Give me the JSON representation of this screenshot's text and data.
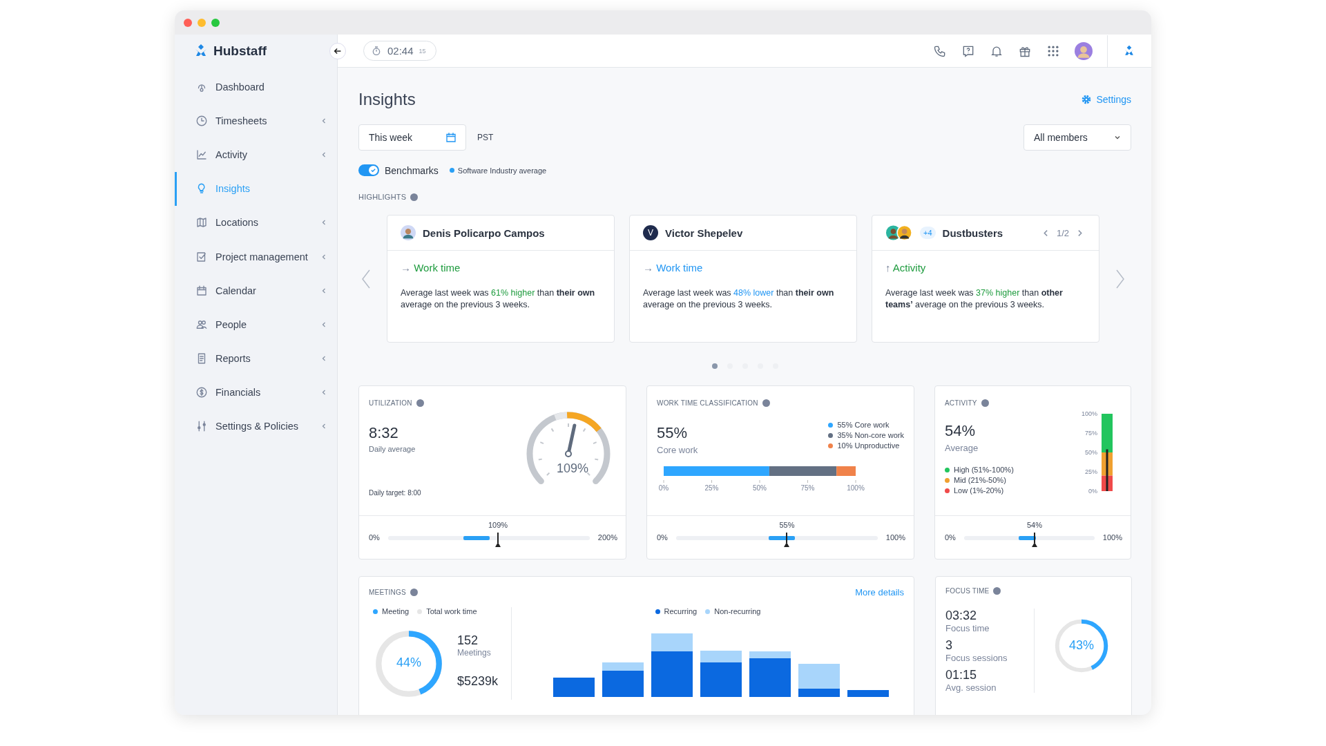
{
  "sidebar": {
    "logo": "Hubstaff",
    "items": [
      {
        "label": "Dashboard",
        "selected": false,
        "expandable": false
      },
      {
        "label": "Timesheets",
        "selected": false,
        "expandable": true
      },
      {
        "label": "Activity",
        "selected": false,
        "expandable": true
      },
      {
        "label": "Insights",
        "selected": true,
        "expandable": false
      },
      {
        "label": "Locations",
        "selected": false,
        "expandable": true
      },
      {
        "label": "Project management",
        "selected": false,
        "expandable": true
      },
      {
        "label": "Calendar",
        "selected": false,
        "expandable": true
      },
      {
        "label": "People",
        "selected": false,
        "expandable": true
      },
      {
        "label": "Reports",
        "selected": false,
        "expandable": true
      },
      {
        "label": "Financials",
        "selected": false,
        "expandable": true
      },
      {
        "label": "Settings & Policies",
        "selected": false,
        "expandable": true
      }
    ]
  },
  "topbar": {
    "timer": "02:44",
    "timer_seconds": "15"
  },
  "page": {
    "title": "Insights",
    "settings": "Settings",
    "date_range": "This week",
    "timezone": "PST",
    "members": "All members",
    "benchmarks": {
      "label": "Benchmarks",
      "on": true
    },
    "benchmark_source": "Software Industry average"
  },
  "highlights": {
    "title": "HIGHLIGHTS",
    "cards": [
      {
        "kind": "person",
        "name": "Denis Policarpo Campos",
        "arrow": "→",
        "metric": "Work time",
        "color": "#1e9b3e",
        "before": "Average last week was ",
        "highlight": "61% higher",
        "after": " than **their own** average on the previous 3 weeks."
      },
      {
        "kind": "initial",
        "initial": "V",
        "name": "Victor Shepelev",
        "arrow": "→",
        "metric": "Work time",
        "color": "#2196f3",
        "before": "Average last week was ",
        "highlight": "48% lower",
        "after": " than **their own** average on the previous 3 weeks."
      },
      {
        "kind": "team",
        "extra": "+4",
        "name": "Dustbusters",
        "pager": "1/2",
        "arrow": "↑",
        "metric": "Activity",
        "color": "#1e9b3e",
        "before": "Average last week was ",
        "highlight": "37% higher",
        "after": " than **other teams’** average on the previous 3 weeks."
      }
    ],
    "pages": [
      {
        "selected": true
      },
      {
        "selected": false
      },
      {
        "selected": false
      },
      {
        "selected": false
      },
      {
        "selected": false
      }
    ]
  },
  "utilization": {
    "title": "UTILIZATION",
    "value": "8:32",
    "caption": "Daily average",
    "target": "Daily target: 8:00",
    "gauge": {
      "level": 0.545,
      "label": "109%"
    },
    "meter": {
      "min": "0%",
      "max": "200%",
      "reading": "109%",
      "level": 0.545
    }
  },
  "work_time_classification": {
    "title": "WORK TIME CLASSIFICATION",
    "value": "55%",
    "caption": "Core work",
    "chart_data": {
      "type": "bar",
      "orientation": "horizontal",
      "stacked": true,
      "series": [
        {
          "name": "55% Core work",
          "color": "#2ea6ff",
          "values": [
            55
          ]
        },
        {
          "name": "35% Non-core work",
          "color": "#637083",
          "values": [
            35
          ]
        },
        {
          "name": "10% Unproductive",
          "color": "#f0824a",
          "values": [
            10
          ]
        }
      ],
      "xlim": [
        0,
        100
      ],
      "xticks": [
        {
          "value": 0,
          "label": "0%"
        },
        {
          "value": 25,
          "label": "25%"
        },
        {
          "value": 50,
          "label": "50%"
        },
        {
          "value": 75,
          "label": "75%"
        },
        {
          "value": 100,
          "label": "100%"
        }
      ]
    },
    "meter": {
      "min": "0%",
      "max": "100%",
      "reading": "55%",
      "level": 0.55
    }
  },
  "activity": {
    "title": "ACTIVITY",
    "value": "54%",
    "caption": "Average",
    "level": 0.54,
    "chart_data": {
      "type": "bar",
      "orientation": "vertical",
      "stacked": true,
      "series": [
        {
          "name": "High (51%-100%)",
          "color": "#22c55e",
          "values": [
            50
          ]
        },
        {
          "name": "Mid (21%-50%)",
          "color": "#f0a030",
          "values": [
            30
          ]
        },
        {
          "name": "Low (1%-20%)",
          "color": "#f04a4a",
          "values": [
            20
          ]
        }
      ],
      "ylim": [
        0,
        100
      ],
      "yticks": [
        {
          "value": 0,
          "label": "0%"
        },
        {
          "value": 25,
          "label": "25%"
        },
        {
          "value": 50,
          "label": "50%"
        },
        {
          "value": 75,
          "label": "75%"
        },
        {
          "value": 100,
          "label": "100%"
        }
      ]
    },
    "meter": {
      "min": "0%",
      "max": "100%",
      "reading": "54%",
      "level": 0.54
    }
  },
  "meetings": {
    "title": "MEETINGS",
    "link": "More details",
    "legend": [
      {
        "label": "Meeting",
        "color": "#2ea6ff"
      },
      {
        "label": "Total work time",
        "color": "#e6e6e6"
      }
    ],
    "donut": {
      "level": 0.44,
      "label": "44%"
    },
    "stats": [
      {
        "value": "152",
        "label": "Meetings"
      },
      {
        "value": "$5239k"
      }
    ],
    "bar_legend": [
      {
        "label": "Recurring",
        "color": "#0b69e0"
      },
      {
        "label": "Non-recurring",
        "color": "#a8d5fb"
      }
    ]
  },
  "focus_time": {
    "title": "FOCUS TIME",
    "stats": [
      {
        "value": "03:32",
        "label": "Focus time"
      },
      {
        "value": "3",
        "label": "Focus sessions"
      },
      {
        "value": "01:15",
        "label": "Avg. session"
      }
    ],
    "donut": {
      "level": 0.43,
      "label": "43%"
    }
  }
}
